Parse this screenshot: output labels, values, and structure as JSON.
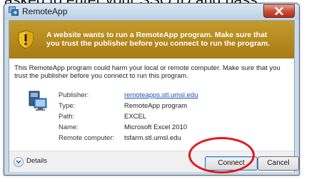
{
  "background_caption": "asked to enter your SSO ID and pass",
  "dialog": {
    "title": "RemoteApp",
    "banner_text": "A website wants to run a RemoteApp program. Make sure that you trust the publisher before you connect to run the program.",
    "warning_text": "This RemoteApp program could harm your local or remote computer. Make sure that you trust the publisher before you connect to run this program.",
    "fields": [
      {
        "label": "Publisher:",
        "value": "remoteapps.stl.umsl.edu"
      },
      {
        "label": "Type:",
        "value": "RemoteApp program"
      },
      {
        "label": "Path:",
        "value": "EXCEL"
      },
      {
        "label": "Name:",
        "value": "Microsoft Excel 2010"
      },
      {
        "label": "Remote computer:",
        "value": "tsfarm.stl.umsl.edu"
      }
    ],
    "details_label": "Details",
    "connect_label": "Connect",
    "cancel_label": "Cancel"
  },
  "colors": {
    "banner": "#b58a1e",
    "highlight_ring": "#e3161c",
    "link": "#1f4fb8",
    "close_button": "#c9503a"
  },
  "icons": [
    "remoteapp-icon",
    "warning-shield-icon",
    "computer-icon",
    "chevron-down-icon",
    "close-icon"
  ]
}
